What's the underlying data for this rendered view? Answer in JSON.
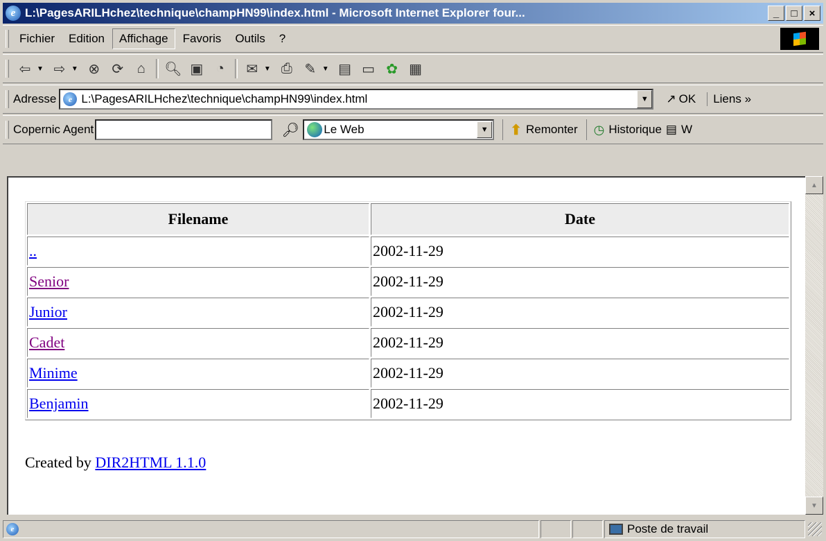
{
  "window": {
    "title": "L:\\PagesARILHchez\\technique\\champHN99\\index.html - Microsoft Internet Explorer four...",
    "controls": [
      "_",
      "□",
      "×"
    ]
  },
  "menu": {
    "items": [
      {
        "label": "Fichier"
      },
      {
        "label": "Edition"
      },
      {
        "label": "Affichage"
      },
      {
        "label": "Favoris"
      },
      {
        "label": "Outils"
      },
      {
        "label": "?"
      }
    ]
  },
  "nav_icons": [
    "back-icon",
    "forward-icon",
    "stop-icon",
    "refresh-icon",
    "home-icon",
    "search-icon",
    "favorites-icon",
    "history-icon",
    "mail-icon",
    "print-icon",
    "edit-icon",
    "discuss-icon",
    "folder-icon",
    "icq-icon",
    "messenger-icon"
  ],
  "address": {
    "label": "Adresse",
    "value": "L:\\PagesARILHchez\\technique\\champHN99\\index.html",
    "go_label": "OK",
    "links_label": "Liens"
  },
  "agent_bar": {
    "label": "Copernic Agent",
    "input_value": "",
    "engine": "Le Web",
    "up_label": "Remonter",
    "history_label": "Historique",
    "truncated_label": "W"
  },
  "page": {
    "table": {
      "headers": [
        "Filename",
        "Date"
      ],
      "rows": [
        {
          "name": "..",
          "date": "2002-11-29",
          "visited": false
        },
        {
          "name": "Senior",
          "date": "2002-11-29",
          "visited": true
        },
        {
          "name": "Junior",
          "date": "2002-11-29",
          "visited": false
        },
        {
          "name": "Cadet",
          "date": "2002-11-29",
          "visited": true
        },
        {
          "name": "Minime",
          "date": "2002-11-29",
          "visited": false
        },
        {
          "name": "Benjamin",
          "date": "2002-11-29",
          "visited": false
        }
      ]
    },
    "credit": {
      "prefix": "Created by",
      "link": "DIR2HTML 1.1.0"
    }
  },
  "status": {
    "zone": "Poste de travail"
  },
  "colors": {
    "link": "#0000ee",
    "visited": "#800080",
    "titlebar_start": "#0a246a",
    "titlebar_end": "#a6caf0",
    "chrome": "#d4d0c8"
  }
}
